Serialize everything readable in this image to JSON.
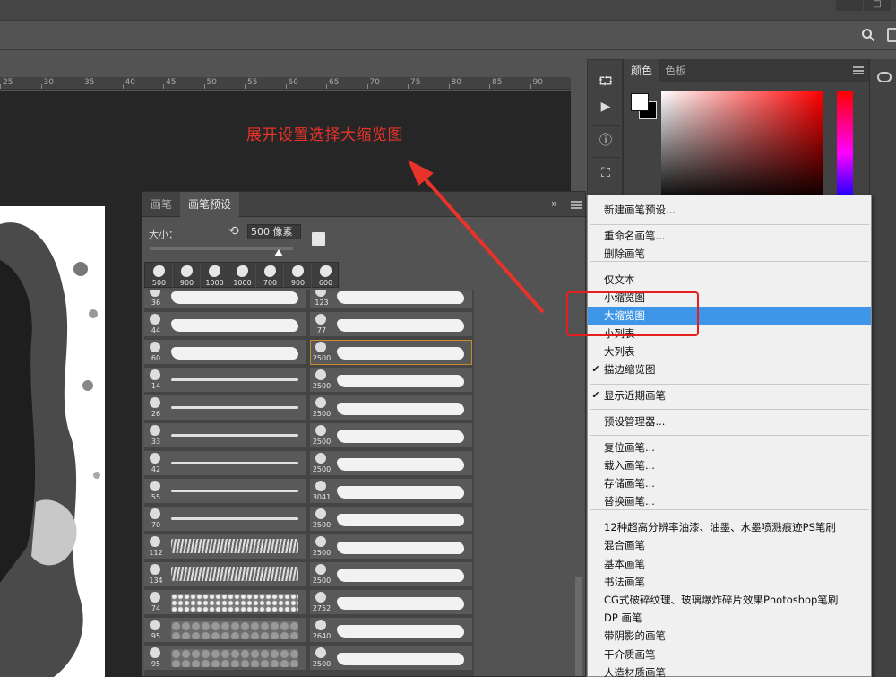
{
  "window": {
    "minimize": "—",
    "maximize": "□"
  },
  "ruler": {
    "ticks": [
      "25",
      "30",
      "35",
      "40",
      "45",
      "50",
      "55",
      "60",
      "65",
      "70",
      "75",
      "80",
      "85",
      "90"
    ]
  },
  "annotation": {
    "text": "展开设置选择大缩览图"
  },
  "color_panel": {
    "tabs": [
      "颜色",
      "色板"
    ]
  },
  "brush_panel": {
    "tabs": [
      "画笔",
      "画笔预设"
    ],
    "size_label": "大小：",
    "size_value": "500 像素",
    "recent_sizes": [
      "500",
      "900",
      "1000",
      "1000",
      "700",
      "900",
      "600"
    ],
    "left_column": [
      "36",
      "44",
      "60",
      "14",
      "26",
      "33",
      "42",
      "55",
      "70",
      "112",
      "134",
      "74",
      "95",
      "95"
    ],
    "right_column": [
      "123",
      "77",
      "2500",
      "2500",
      "2500",
      "2500",
      "2500",
      "3041",
      "2500",
      "2500",
      "2500",
      "2752",
      "2640",
      "2500"
    ]
  },
  "context_menu": {
    "items": [
      {
        "label": "新建画笔预设...",
        "checked": false,
        "highlight": false
      },
      {
        "label": "重命名画笔...",
        "checked": false,
        "highlight": false
      },
      {
        "label": "删除画笔",
        "checked": false,
        "highlight": false
      },
      {
        "label": "仅文本",
        "checked": false,
        "highlight": false
      },
      {
        "label": "小缩览图",
        "checked": false,
        "highlight": false
      },
      {
        "label": "大缩览图",
        "checked": false,
        "highlight": true
      },
      {
        "label": "小列表",
        "checked": false,
        "highlight": false
      },
      {
        "label": "大列表",
        "checked": false,
        "highlight": false
      },
      {
        "label": "描边缩览图",
        "checked": true,
        "highlight": false
      },
      {
        "label": "显示近期画笔",
        "checked": true,
        "highlight": false
      },
      {
        "label": "预设管理器...",
        "checked": false,
        "highlight": false
      },
      {
        "label": "复位画笔...",
        "checked": false,
        "highlight": false
      },
      {
        "label": "载入画笔...",
        "checked": false,
        "highlight": false
      },
      {
        "label": "存储画笔...",
        "checked": false,
        "highlight": false
      },
      {
        "label": "替换画笔...",
        "checked": false,
        "highlight": false
      },
      {
        "label": "12种超高分辨率油漆、油墨、水墨喷溅痕迹PS笔刷",
        "checked": false,
        "highlight": false
      },
      {
        "label": "混合画笔",
        "checked": false,
        "highlight": false
      },
      {
        "label": "基本画笔",
        "checked": false,
        "highlight": false
      },
      {
        "label": "书法画笔",
        "checked": false,
        "highlight": false
      },
      {
        "label": "CG式破碎纹理、玻璃爆炸碎片效果Photoshop笔刷",
        "checked": false,
        "highlight": false
      },
      {
        "label": "DP 画笔",
        "checked": false,
        "highlight": false
      },
      {
        "label": "带阴影的画笔",
        "checked": false,
        "highlight": false
      },
      {
        "label": "干介质画笔",
        "checked": false,
        "highlight": false
      },
      {
        "label": "人造材质画笔",
        "checked": false,
        "highlight": false
      }
    ]
  },
  "colors": {
    "annotation_red": "#e8332a",
    "menu_highlight": "#3d96e8",
    "selected_outline": "#c98a2b"
  }
}
